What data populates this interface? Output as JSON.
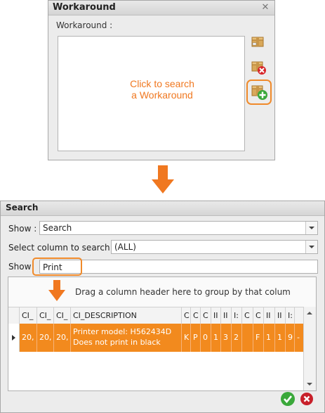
{
  "workaround_window": {
    "title": "Workaround",
    "close_glyph": "✕",
    "field_label": "Workaround :",
    "icons": [
      "box-icon",
      "box-delete-icon",
      "box-add-icon"
    ],
    "callout": "Click to search a Workaround"
  },
  "search_window": {
    "title": "Search",
    "show_label": "Show :",
    "show_value": "Search",
    "select_column_label": "Select column to search :",
    "select_column_value": "(ALL)",
    "show2_label": "Show",
    "search_text": "Print",
    "group_panel_text": "Drag a column header here to group by that colum",
    "columns": [
      "CI_",
      "CI_",
      "CI_",
      "CI_DESCRIPTION",
      "C",
      "C",
      "C",
      "II",
      "II",
      "I:",
      "C",
      "C",
      "II",
      "II",
      "I:"
    ],
    "row": [
      "20,",
      "20,",
      "20,",
      "Printer model: H562434D Does not print in black",
      "K",
      "P",
      "0",
      "1",
      "3",
      "2",
      "",
      "F",
      "1",
      "1",
      "9",
      "-"
    ],
    "ok_icon": "ok-check-icon",
    "cancel_icon": "cancel-x-icon"
  },
  "colors": {
    "accent": "#f28a1e",
    "callout": "#f07820",
    "window_bg": "#ececec"
  }
}
